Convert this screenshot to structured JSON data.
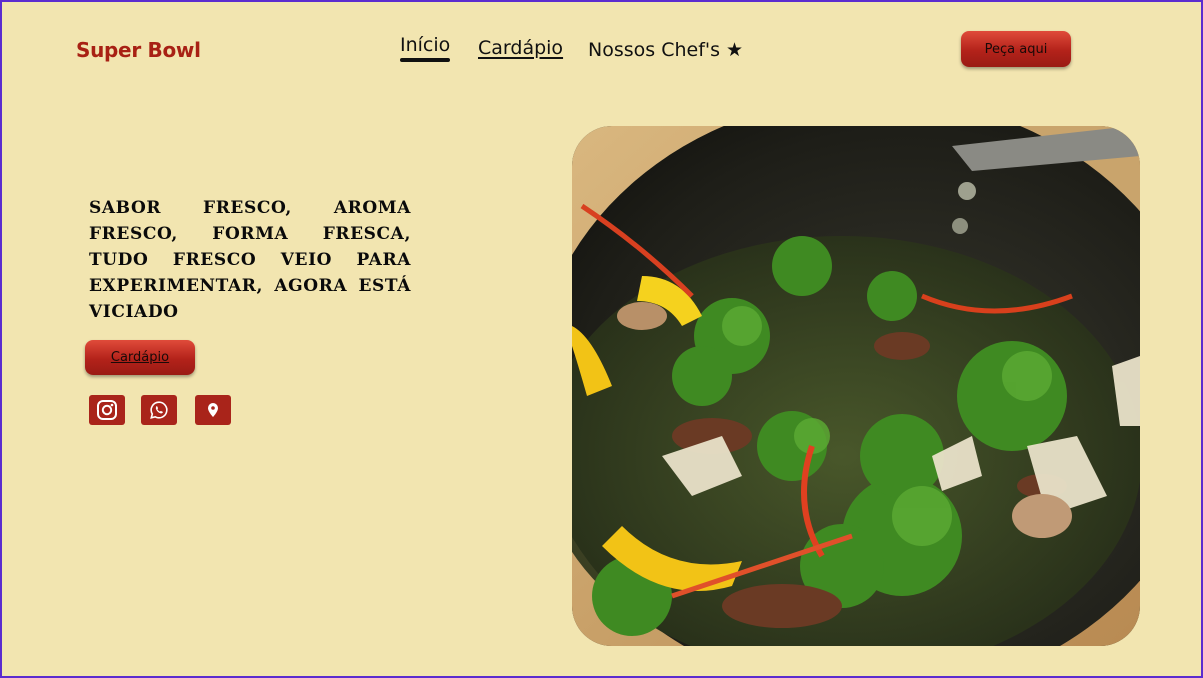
{
  "header": {
    "brand": "Super Bowl",
    "nav": {
      "inicio": "Início",
      "cardapio": "Cardápio",
      "chefs": "Nossos Chef's ★"
    },
    "order_button": "Peça aqui"
  },
  "hero": {
    "tagline": "Sabor fresco, aroma fresco, forma fresca, tudo fresco veio para experimentar, agora está viciado",
    "menu_button": "Cardápio",
    "image_icon": "stir-fry-wok-photo"
  },
  "social": [
    {
      "icon": "instagram-icon"
    },
    {
      "icon": "whatsapp-icon"
    },
    {
      "icon": "location-pin-icon"
    }
  ],
  "colors": {
    "background": "#f2e5b0",
    "brand": "#a82114",
    "button": "#b3221a",
    "frame_border": "#5b2ccf"
  }
}
